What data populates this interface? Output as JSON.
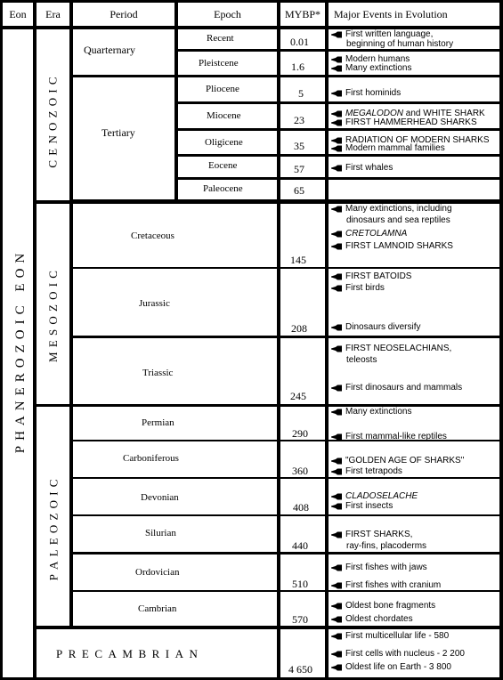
{
  "header": {
    "eon": "Eon",
    "era": "Era",
    "period": "Period",
    "epoch": "Epoch",
    "mybp": "MYBP*",
    "events": "Major Events in Evolution"
  },
  "eon_label": "PHANEROZOIC EON",
  "eras": {
    "cenozoic": "CENOZOIC",
    "mesozoic": "MESOZOIC",
    "paleozoic": "PALEOZOIC",
    "precambrian": "PRECAMBRIAN"
  },
  "periods": {
    "quaternary": "Quarternary",
    "tertiary": "Tertiary",
    "cretaceous": "Cretaceous",
    "jurassic": "Jurassic",
    "triassic": "Triassic",
    "permian": "Permian",
    "carboniferous": "Carboniferous",
    "devonian": "Devonian",
    "silurian": "Silurian",
    "ordovician": "Ordovician",
    "cambrian": "Cambrian"
  },
  "epochs": {
    "recent": "Recent",
    "pleistocene": "Pleistcene",
    "pliocene": "Pliocene",
    "miocene": "Miocene",
    "oligocene": "Oligicene",
    "eocene": "Eocene",
    "paleocene": "Paleocene"
  },
  "mybp": {
    "recent": "0.01",
    "pleistocene": "1.6",
    "pliocene": "5",
    "miocene": "23",
    "oligocene": "35",
    "eocene": "57",
    "paleocene": "65",
    "cretaceous": "145",
    "jurassic": "208",
    "triassic": "245",
    "permian": "290",
    "carboniferous": "360",
    "devonian": "408",
    "silurian": "440",
    "ordovician": "510",
    "cambrian": "570",
    "precambrian": "4 650"
  },
  "events": {
    "recent": [
      "First written language,",
      "beginning of human history"
    ],
    "pleistocene": [
      "Modern humans",
      "Many extinctions"
    ],
    "pliocene": [
      "First hominids"
    ],
    "miocene": [
      {
        "italic": "MEGALODON",
        "rest": " and WHITE SHARK"
      },
      "FIRST HAMMERHEAD SHARKS"
    ],
    "oligocene": [
      "RADIATION OF MODERN SHARKS",
      "Modern mammal families"
    ],
    "eocene": [
      "First whales"
    ],
    "cretaceous": [
      "Many extinctions, including",
      "dinosaurs and sea reptiles",
      "CRETOLAMNA",
      "FIRST LAMNOID SHARKS"
    ],
    "jurassic": [
      "FIRST BATOIDS",
      "First birds",
      "Dinosaurs diversify"
    ],
    "triassic": [
      "FIRST NEOSELACHIANS,",
      "teleosts",
      "First dinosaurs and mammals"
    ],
    "permian": [
      "Many extinctions",
      "First mammal-like reptiles"
    ],
    "carboniferous": [
      "\"GOLDEN AGE OF SHARKS\"",
      "First tetrapods"
    ],
    "devonian": [
      "CLADOSELACHE",
      "First insects"
    ],
    "silurian": [
      "FIRST SHARKS,",
      "ray-fins, placoderms"
    ],
    "ordovician": [
      "First fishes with jaws",
      "First fishes with cranium"
    ],
    "cambrian": [
      "Oldest bone fragments",
      "Oldest chordates"
    ],
    "precambrian": [
      "First multicellular life - 580",
      "First cells with nucleus - 2 200",
      "Oldest life on Earth - 3 800"
    ]
  }
}
